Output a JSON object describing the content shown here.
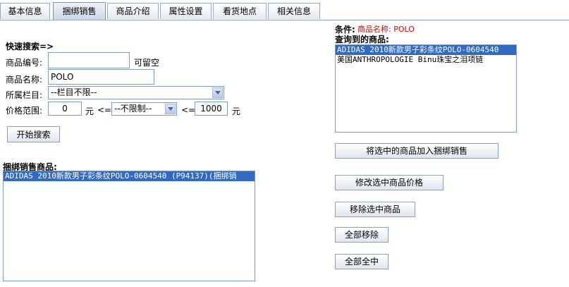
{
  "tabs": [
    {
      "label": "基本信息"
    },
    {
      "label": "捆绑销售"
    },
    {
      "label": "商品介绍"
    },
    {
      "label": "属性设置"
    },
    {
      "label": "看货地点"
    },
    {
      "label": "相关信息"
    }
  ],
  "active_tab": "捆绑销售",
  "quick_search": {
    "title": "快速搜索=>",
    "product_code_label": "商品编号:",
    "product_code_value": "",
    "product_code_hint": "可留空",
    "product_name_label": "商品名称:",
    "product_name_value": "POLO",
    "category_label": "所属栏目:",
    "category_selected": "--栏目不限--",
    "price_range_label": "价格范围:",
    "price_min": "0",
    "currency_unit": "元",
    "lte_symbol": "<=",
    "price_filter_selected": "--不限制--",
    "price_max": "1000",
    "search_button": "开始搜索"
  },
  "conditions": {
    "label": "条件:",
    "text": "商品名称: POLO"
  },
  "found_products": {
    "label": "查询到的商品:",
    "items": [
      {
        "text": "ADIDAS 2010新款男子彩条纹POLO-0604540",
        "selected": true
      },
      {
        "text": "美国ANTHROPOLOGIE Binu珠宝之泪项链",
        "selected": false
      }
    ]
  },
  "bundle_products": {
    "label": "捆绑销售商品:",
    "items": [
      {
        "text": "ADIDAS 2010新款男子彩条纹POLO-0604540 (P94137)(捆绑销",
        "selected": true
      }
    ]
  },
  "actions": {
    "add_selected": "将选中的商品加入捆绑销售",
    "modify_price": "修改选中商品价格",
    "remove_selected": "移除选中商品",
    "remove_all": "全部移除",
    "select_all": "全部全中"
  },
  "colors": {
    "selection": "#316ac5",
    "condition_value": "#e00000",
    "tab_border": "#9aa9bd",
    "input_border": "#7f9db9"
  }
}
